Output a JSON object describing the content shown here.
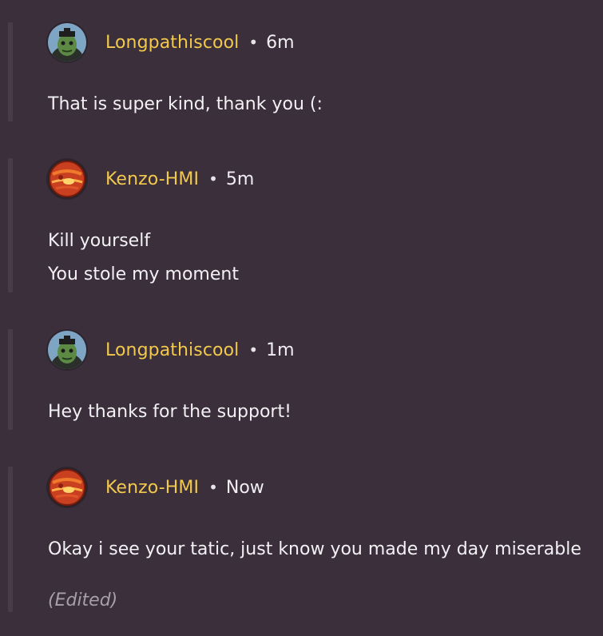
{
  "comments": [
    {
      "user": "Longpathiscool",
      "separator": "•",
      "time": "6m",
      "lines": [
        "That is super kind, thank you (:"
      ]
    },
    {
      "user": "Kenzo-HMI",
      "separator": "•",
      "time": "5m",
      "lines": [
        "Kill yourself",
        "You stole my moment"
      ]
    },
    {
      "user": "Longpathiscool",
      "separator": "•",
      "time": "1m",
      "lines": [
        "Hey thanks for the support!"
      ]
    },
    {
      "user": "Kenzo-HMI",
      "separator": "•",
      "time": "Now",
      "lines": [
        "Okay i see your tatic, just know you made my day miserable"
      ],
      "edited_label": "(Edited)"
    }
  ],
  "colors": {
    "background": "#3a2f3b",
    "username": "#f2c94c",
    "text": "#f3f1f4",
    "edited": "#a79fab"
  },
  "icons": {
    "longpath_avatar": "green-character-avatar-icon",
    "kenzo_avatar": "orange-planet-avatar-icon"
  }
}
